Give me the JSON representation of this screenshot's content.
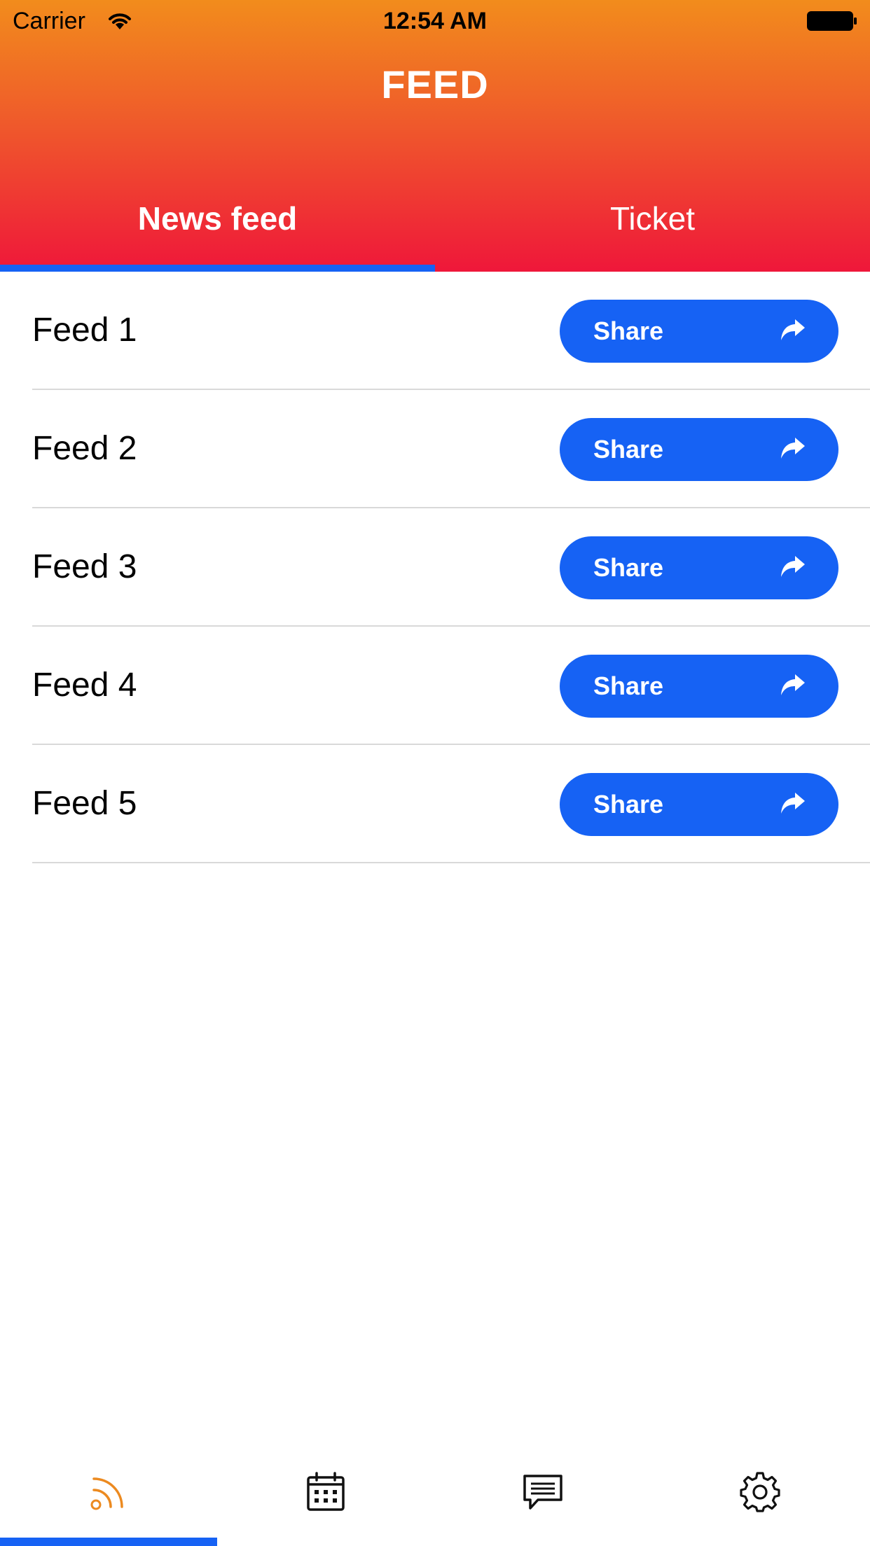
{
  "status_bar": {
    "carrier": "Carrier",
    "time": "12:54 AM"
  },
  "header": {
    "title": "FEED",
    "tabs": [
      {
        "label": "News feed",
        "selected": true
      },
      {
        "label": "Ticket",
        "selected": false
      }
    ]
  },
  "feed": {
    "items": [
      {
        "label": "Feed 1",
        "button": "Share"
      },
      {
        "label": "Feed 2",
        "button": "Share"
      },
      {
        "label": "Feed 3",
        "button": "Share"
      },
      {
        "label": "Feed 4",
        "button": "Share"
      },
      {
        "label": "Feed 5",
        "button": "Share"
      }
    ]
  },
  "tabbar": {
    "items": [
      {
        "icon": "rss-feed-icon",
        "selected": true
      },
      {
        "icon": "calendar-icon",
        "selected": false
      },
      {
        "icon": "message-icon",
        "selected": false
      },
      {
        "icon": "settings-gear-icon",
        "selected": false
      }
    ]
  },
  "colors": {
    "header_gradient_top": "#f28c1c",
    "header_gradient_bottom": "#ef173a",
    "accent_blue": "#1662f4",
    "active_tab_icon": "#ec8a20"
  }
}
